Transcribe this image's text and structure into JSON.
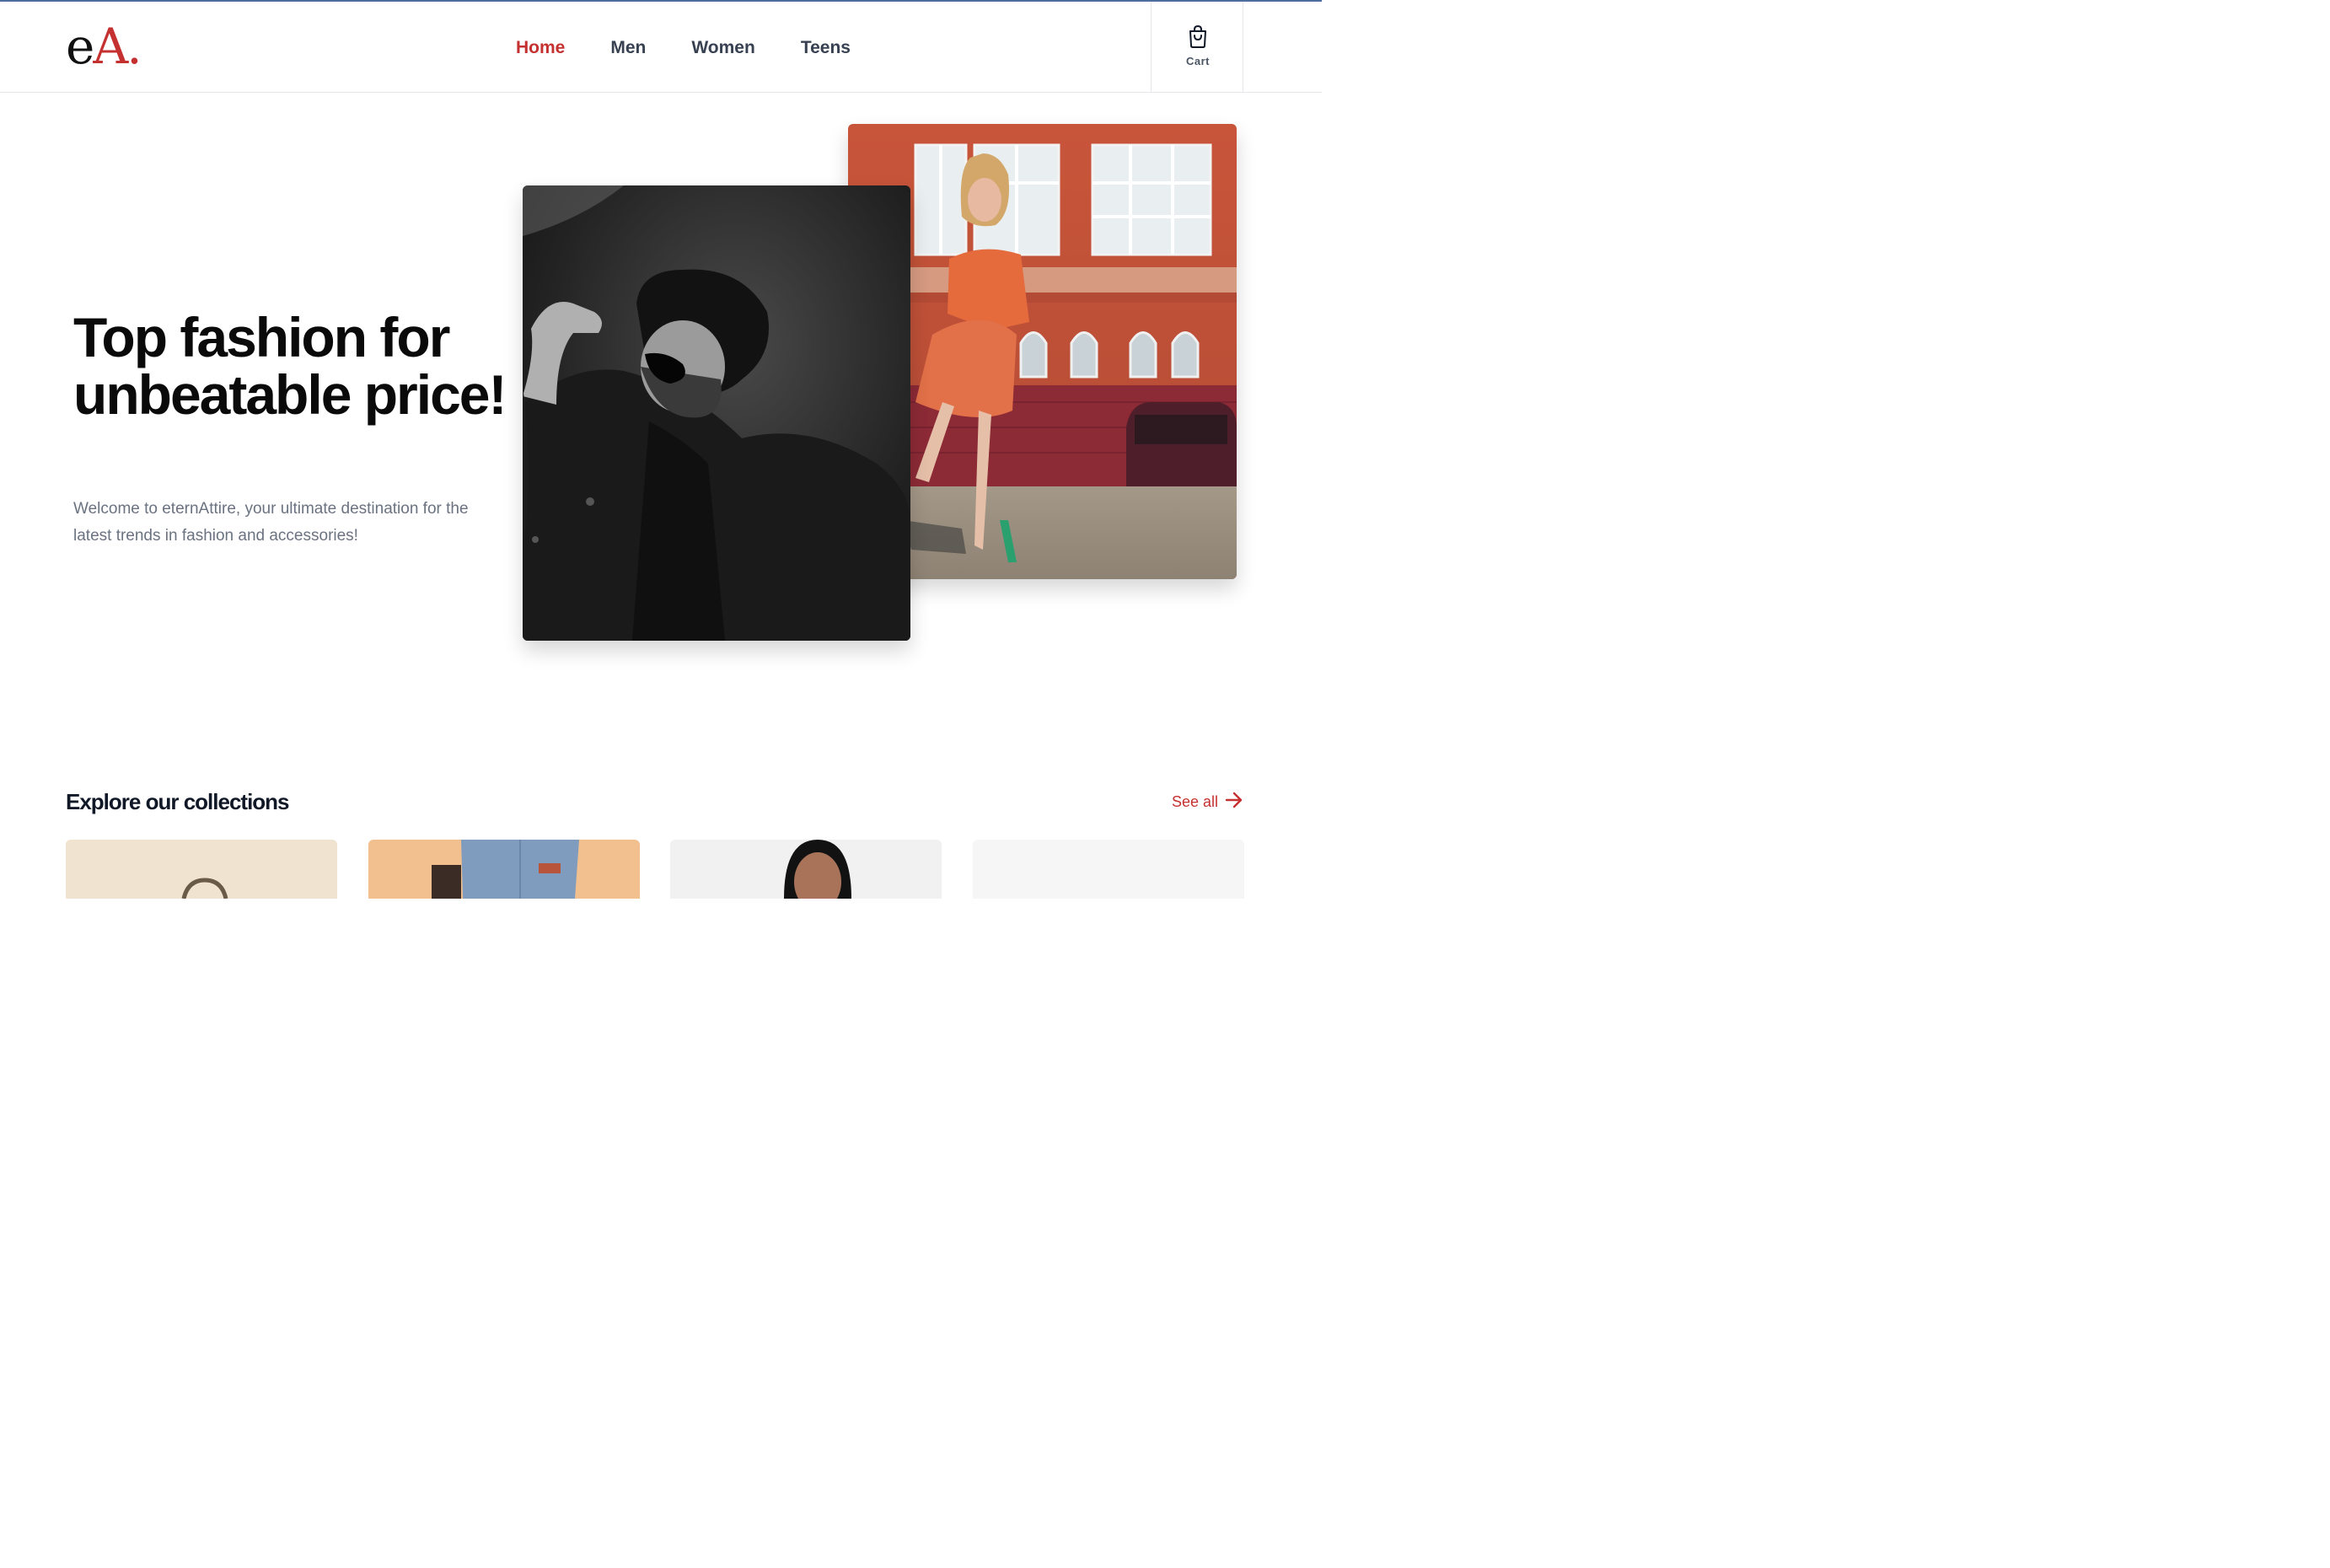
{
  "brand": {
    "logo_e": "e",
    "logo_a": "A",
    "logo_dot": ".",
    "accent_color": "#c53030"
  },
  "nav": {
    "items": [
      {
        "label": "Home",
        "active": true
      },
      {
        "label": "Men",
        "active": false
      },
      {
        "label": "Women",
        "active": false
      },
      {
        "label": "Teens",
        "active": false
      }
    ]
  },
  "cart": {
    "label": "Cart",
    "icon": "shopping-bag-icon"
  },
  "hero": {
    "title": "Top fashion for unbeatable price!",
    "subtitle": "Welcome to eternAttire, your ultimate destination for the latest trends in fashion and accessories!"
  },
  "collections": {
    "title": "Explore our collections",
    "see_all_label": "See all",
    "see_all_icon": "arrow-right-icon",
    "cards": [
      {
        "name": "collection-card-bag"
      },
      {
        "name": "collection-card-jeans"
      },
      {
        "name": "collection-card-portrait"
      },
      {
        "name": "collection-card-empty"
      }
    ]
  }
}
